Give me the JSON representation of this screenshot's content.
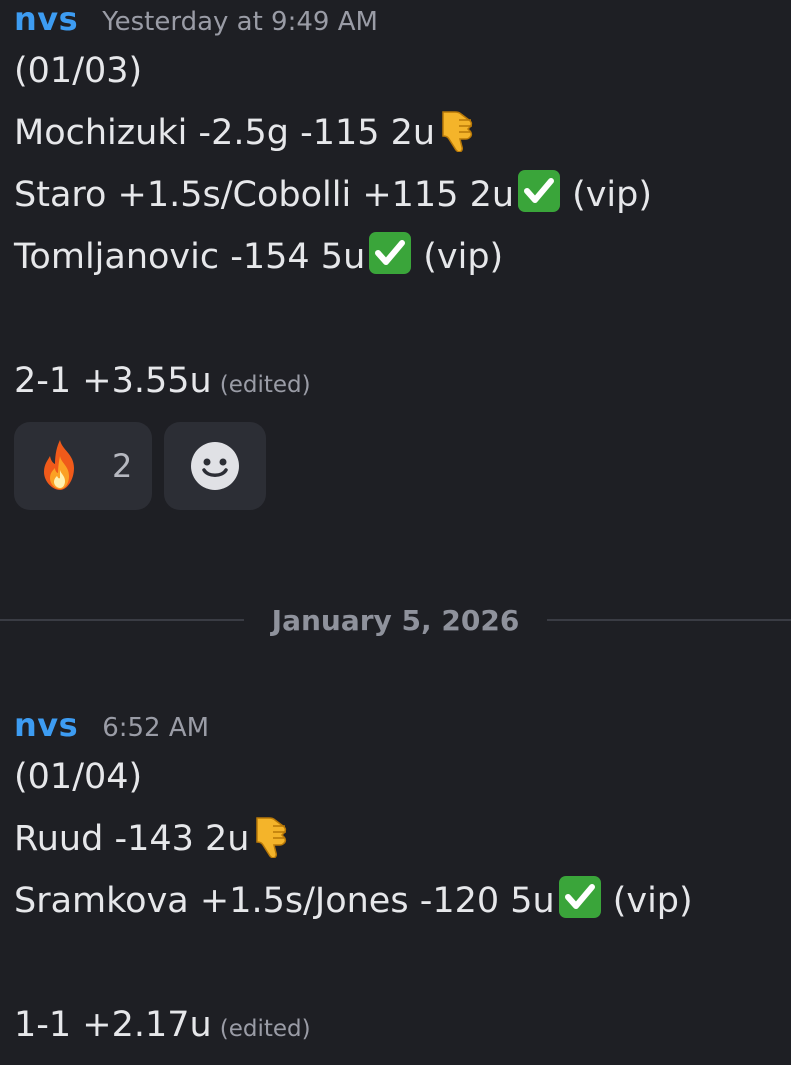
{
  "messages": [
    {
      "username": "nvs",
      "timestamp": "Yesterday at 9:49 AM",
      "lines": [
        {
          "text": "(01/03)"
        },
        {
          "text": "Mochizuki -2.5g -115 2u",
          "emoji": "thumbs-down-icon"
        },
        {
          "text": "Staro +1.5s/Cobolli +115 2u",
          "emoji": "check-mark-icon",
          "suffix": "(vip)"
        },
        {
          "text": "Tomljanovic -154 5u",
          "emoji": "check-mark-icon",
          "suffix": "(vip)"
        }
      ],
      "summary": "2-1 +3.55u",
      "edited": "(edited)",
      "reactions": [
        {
          "emoji": "fire-icon",
          "count": "2"
        }
      ],
      "add_reaction_icon": "smile-add-reaction-icon"
    },
    {
      "username": "nvs",
      "timestamp": "6:52 AM",
      "lines": [
        {
          "text": "(01/04)"
        },
        {
          "text": "Ruud -143 2u",
          "emoji": "thumbs-down-icon"
        },
        {
          "text": "Sramkova +1.5s/Jones -120 5u",
          "emoji": "check-mark-icon",
          "suffix": "(vip)"
        }
      ],
      "summary": "1-1 +2.17u",
      "edited": "(edited)"
    }
  ],
  "date_divider": "January 5, 2026",
  "colors": {
    "background": "#1e1f24",
    "username": "#3d9cf2",
    "check": "#3aa53a",
    "thumbs": "#f4b42a",
    "reaction_bg": "#2c2e35"
  }
}
